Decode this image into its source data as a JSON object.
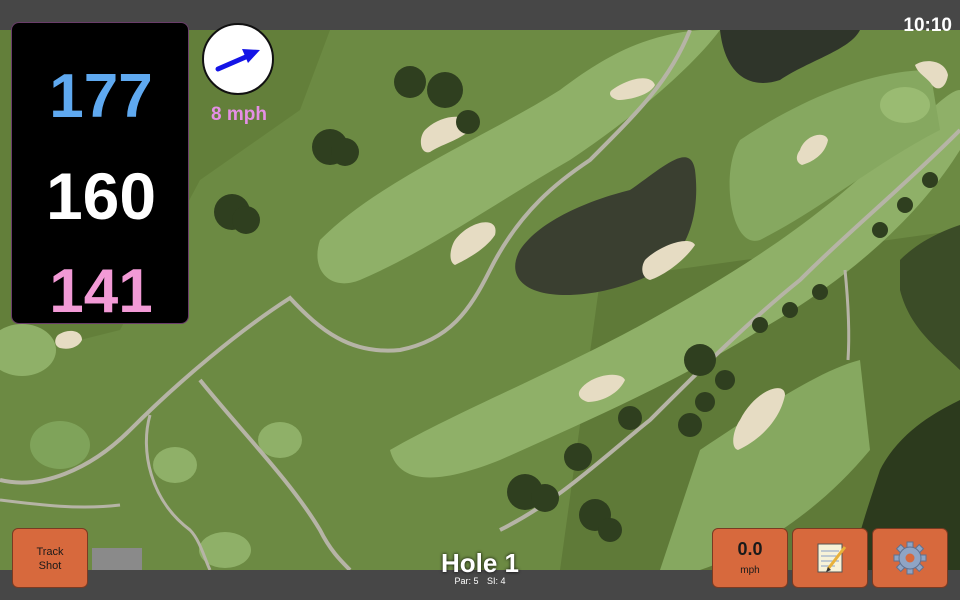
{
  "status": {
    "time": "10:10"
  },
  "distances": {
    "back": "177",
    "middle": "160",
    "front": "141",
    "colors": {
      "back": "#5fa9f0",
      "middle": "#ffffff",
      "front": "#f29ad6"
    }
  },
  "wind": {
    "label": "8 mph",
    "icon": "wind-arrow-icon",
    "color": "#e58fe6"
  },
  "hole": {
    "title": "Hole 1",
    "par": "Par: 5",
    "si": "SI: 4"
  },
  "buttons": {
    "track_shot_line1": "Track",
    "track_shot_line2": "Shot",
    "speed_value": "0.0",
    "speed_unit": "mph",
    "notes_icon": "notepad-icon",
    "settings_icon": "gear-icon"
  },
  "theme": {
    "button": "#d7693d",
    "bar": "#474747"
  }
}
